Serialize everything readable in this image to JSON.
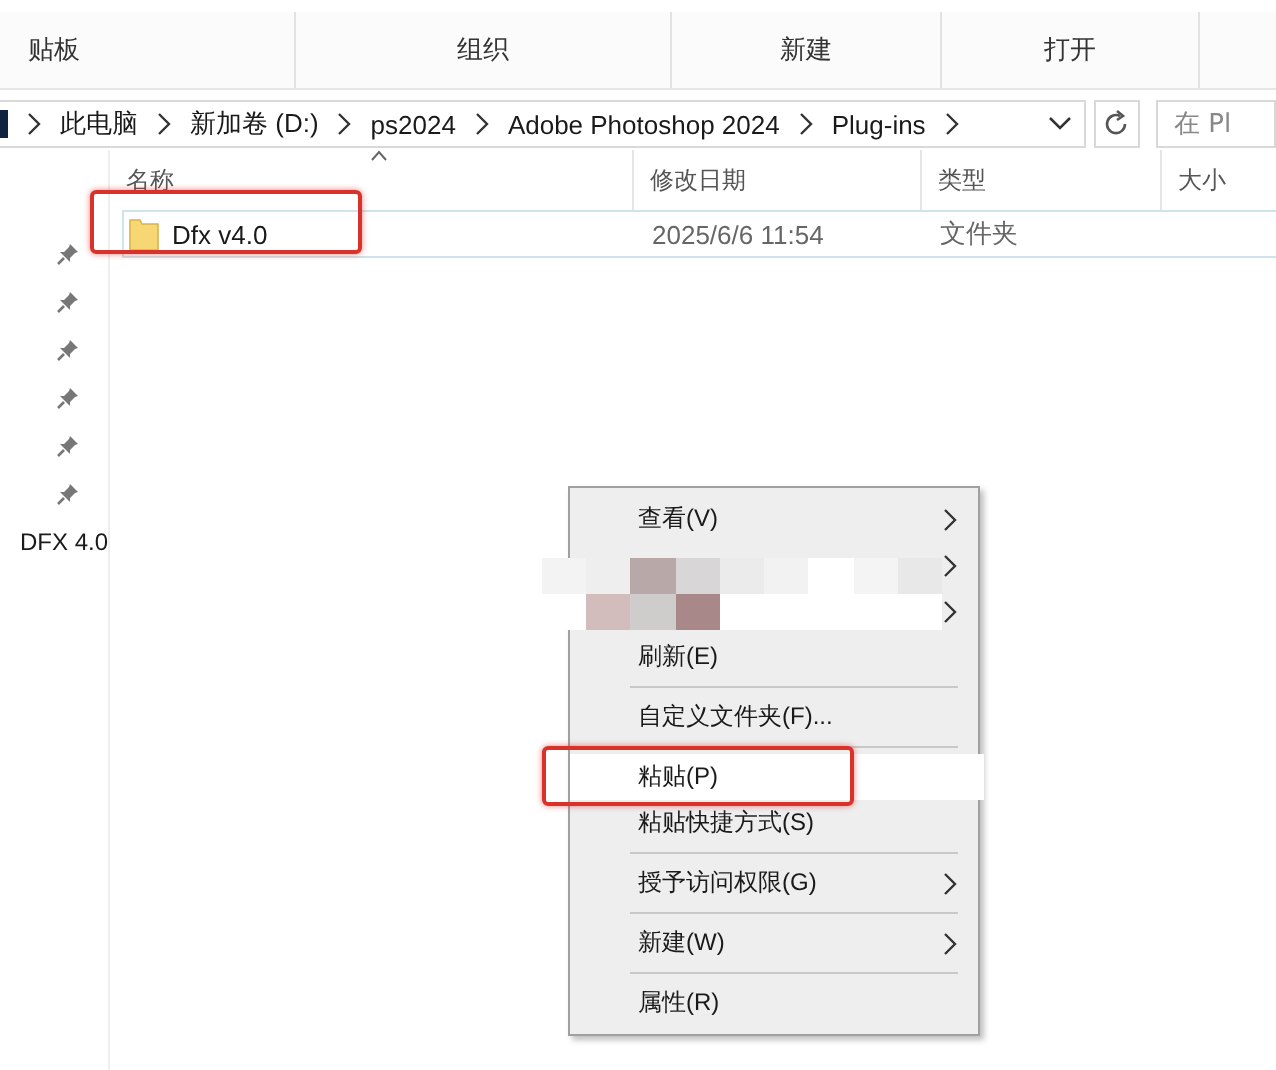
{
  "ribbon_groups": [
    "贴板",
    "组织",
    "新建",
    "打开"
  ],
  "breadcrumb": [
    "此电脑",
    "新加卷 (D:)",
    "ps2024",
    "Adobe Photoshop 2024",
    "Plug-ins"
  ],
  "search": {
    "placeholder": "在 Pl"
  },
  "nav_pane": {
    "pinned_count_items": [
      {
        "pinned": true
      },
      {
        "pinned": true
      },
      {
        "pinned": true
      },
      {
        "pinned": true
      },
      {
        "pinned": true
      },
      {
        "pinned": true
      }
    ],
    "item_label": "DFX 4.0"
  },
  "table": {
    "columns": [
      "名称",
      "修改日期",
      "类型",
      "大小"
    ],
    "rows": [
      {
        "name": "Dfx v4.0",
        "modified": "2025/6/6 11:54",
        "type": "文件夹",
        "size": "",
        "annotated": true
      }
    ]
  },
  "context_menu": [
    {
      "kind": "item",
      "label": "查看(V)",
      "submenu": true,
      "selected": false,
      "annotated": false
    },
    {
      "kind": "obscured",
      "submenu": true
    },
    {
      "kind": "obscured",
      "submenu": true
    },
    {
      "kind": "item",
      "label": "刷新(E)",
      "submenu": false,
      "selected": false,
      "annotated": false
    },
    {
      "kind": "separator"
    },
    {
      "kind": "item",
      "label": "自定义文件夹(F)...",
      "submenu": false,
      "selected": false,
      "annotated": false
    },
    {
      "kind": "separator"
    },
    {
      "kind": "item",
      "label": "粘贴(P)",
      "submenu": false,
      "selected": true,
      "annotated": true
    },
    {
      "kind": "item",
      "label": "粘贴快捷方式(S)",
      "submenu": false,
      "selected": false,
      "annotated": false
    },
    {
      "kind": "separator"
    },
    {
      "kind": "item",
      "label": "授予访问权限(G)",
      "submenu": true,
      "selected": false,
      "annotated": false
    },
    {
      "kind": "separator"
    },
    {
      "kind": "item",
      "label": "新建(W)",
      "submenu": true,
      "selected": false,
      "annotated": false
    },
    {
      "kind": "separator"
    },
    {
      "kind": "item",
      "label": "属性(R)",
      "submenu": false,
      "selected": false,
      "annotated": false
    }
  ]
}
